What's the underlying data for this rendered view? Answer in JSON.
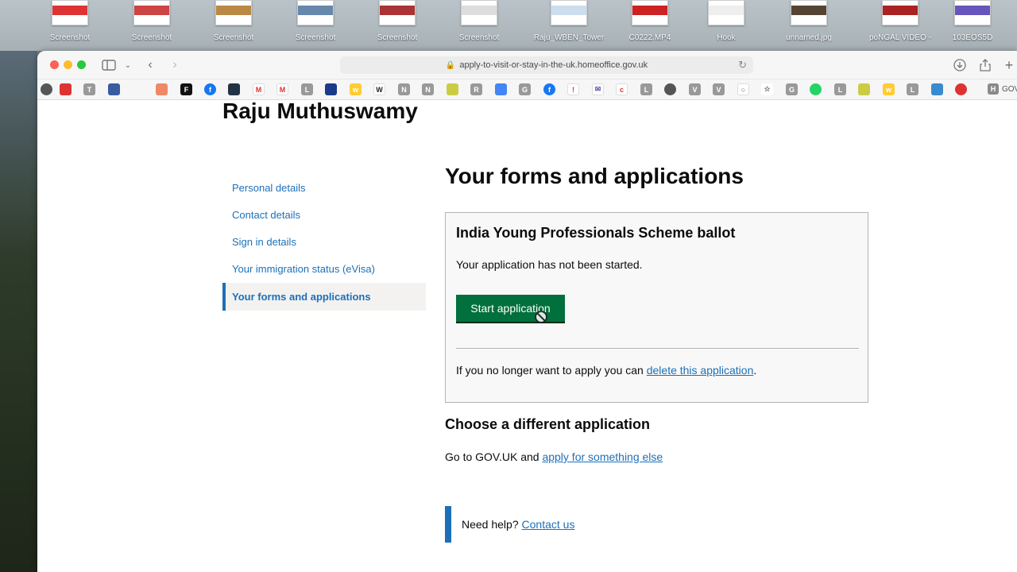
{
  "desktop": {
    "icons": [
      {
        "label": "Screenshot",
        "band": "#d33"
      },
      {
        "label": "Screenshot",
        "band": "#c44"
      },
      {
        "label": "Screenshot",
        "band": "#b84"
      },
      {
        "label": "Screenshot",
        "band": "#68a"
      },
      {
        "label": "Screenshot",
        "band": "#a33"
      },
      {
        "label": "Screenshot",
        "band": "#ddd"
      },
      {
        "label": "Raju_WBEN_Tower",
        "band": "#cde"
      },
      {
        "label": "C0222.MP4",
        "band": "#c22"
      },
      {
        "label": "Hook",
        "band": "#eee"
      },
      {
        "label": "unnamed.jpg",
        "band": "#543"
      },
      {
        "label": "poNGAL VIDEO -",
        "band": "#a22"
      },
      {
        "label": "103EOS5D",
        "band": "#65b"
      }
    ]
  },
  "browser": {
    "url": "apply-to-visit-or-stay-in-the-uk.homeoffice.gov.uk",
    "bookmark_last": "GOV"
  },
  "page": {
    "user_name": "Raju Muthuswamy",
    "nav": [
      {
        "label": "Personal details"
      },
      {
        "label": "Contact details"
      },
      {
        "label": "Sign in details"
      },
      {
        "label": "Your immigration status (eVisa)"
      },
      {
        "label": "Your forms and applications"
      }
    ],
    "heading": "Your forms and applications",
    "card": {
      "title": "India Young Professionals Scheme ballot",
      "status": "Your application has not been started.",
      "start_button": "Start application",
      "delete_prefix": "If you no longer want to apply you can ",
      "delete_link": "delete this application",
      "delete_suffix": "."
    },
    "sub_heading": "Choose a different application",
    "goto_prefix": "Go to GOV.UK and ",
    "goto_link": "apply for something else",
    "help_prefix": "Need help? ",
    "help_link": "Contact us"
  }
}
